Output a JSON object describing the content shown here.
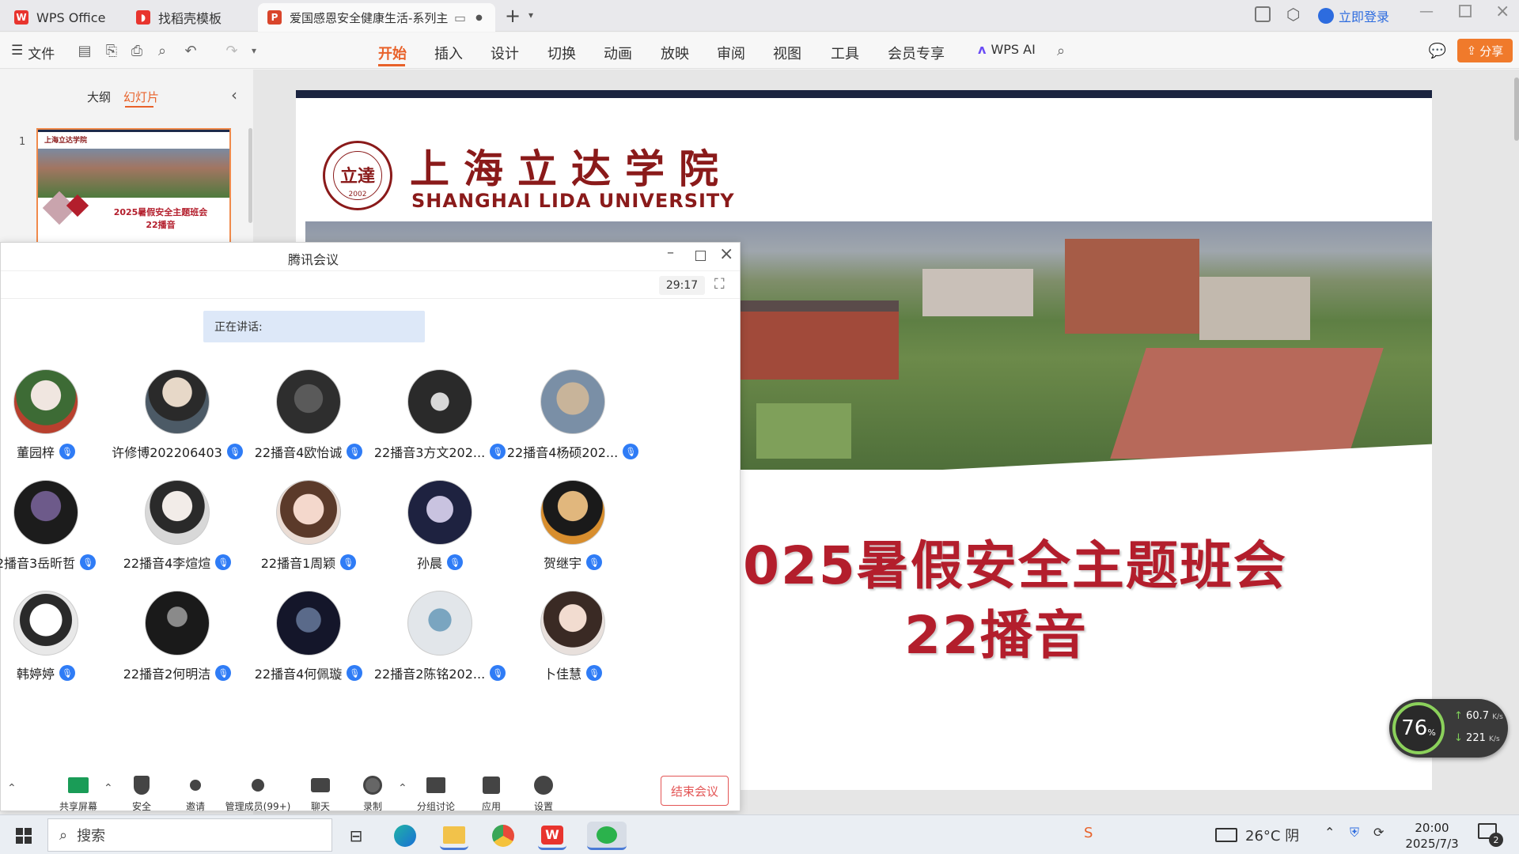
{
  "titlebar": {
    "tabs": [
      {
        "label": "WPS Office"
      },
      {
        "label": "找稻壳模板"
      },
      {
        "label": "爱国感恩安全健康生活-系列主"
      }
    ],
    "login_label": "立即登录"
  },
  "ribbon": {
    "file_label": "文件",
    "menus": [
      "开始",
      "插入",
      "设计",
      "切换",
      "动画",
      "放映",
      "审阅",
      "视图",
      "工具",
      "会员专享"
    ],
    "ai_label": "WPS AI",
    "share_label": "分享"
  },
  "leftpane": {
    "tab_outline": "大纲",
    "tab_slides": "幻灯片",
    "slide_number": "1"
  },
  "slide": {
    "school_cn": "上海立达学院",
    "school_en": "SHANGHAI LIDA UNIVERSITY",
    "seal_year": "2002",
    "seal_text": "SHANGHAI LIDA UNIVERSITY",
    "title_line1": "2025暑假安全主题班会",
    "title_line2": "22播音"
  },
  "meeting": {
    "window_title": "腾讯会议",
    "timer": "29:17",
    "speaking_label": "正在讲话:",
    "participants": [
      {
        "name": "董园梓"
      },
      {
        "name": "许修博202206403"
      },
      {
        "name": "22播音4欧怡诚"
      },
      {
        "name": "22播音3方文202..."
      },
      {
        "name": "22播音4杨硕202..."
      },
      {
        "name": "2播音3岳昕哲"
      },
      {
        "name": "22播音4李煊煊"
      },
      {
        "name": "22播音1周颖"
      },
      {
        "name": "孙晨"
      },
      {
        "name": "贺继宇"
      },
      {
        "name": "韩婷婷"
      },
      {
        "name": "22播音2何明洁"
      },
      {
        "name": "22播音4何佩璇"
      },
      {
        "name": "22播音2陈铭202..."
      },
      {
        "name": "卜佳慧"
      }
    ],
    "controls": [
      "共享屏幕",
      "安全",
      "邀请",
      "管理成员(99+)",
      "聊天",
      "录制",
      "分组讨论",
      "应用",
      "设置"
    ],
    "end_label": "结束会议"
  },
  "netmon": {
    "cpu": "76",
    "cpu_unit": "%",
    "up": "60.7",
    "down": "221",
    "rate_unit": "K/s"
  },
  "taskbar": {
    "search_placeholder": "搜索",
    "weather": "26°C 阴",
    "time": "20:00",
    "date": "2025/7/3",
    "notif_count": "2"
  }
}
